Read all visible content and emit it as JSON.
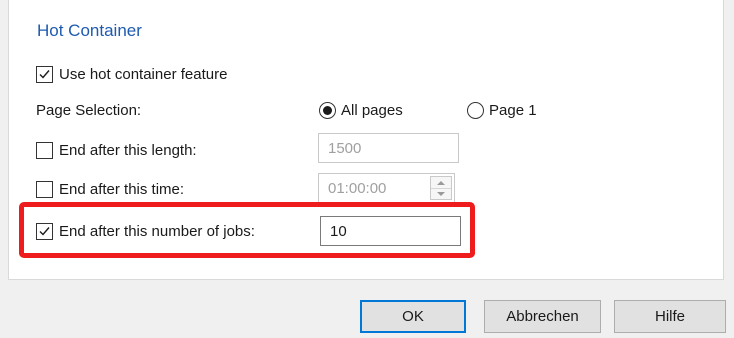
{
  "section": {
    "title": "Hot Container"
  },
  "options": {
    "use_hot_container": {
      "label": "Use hot container feature",
      "checked": true
    },
    "page_selection": {
      "label": "Page Selection:",
      "choices": [
        {
          "label": "All pages",
          "selected": true
        },
        {
          "label": "Page 1",
          "selected": false
        }
      ]
    },
    "end_length": {
      "label": "End after this length:",
      "checked": false,
      "value": "1500"
    },
    "end_time": {
      "label": "End after this time:",
      "checked": false,
      "value": "01:00:00"
    },
    "end_jobs": {
      "label": "End after this number of jobs:",
      "checked": true,
      "value": "10"
    }
  },
  "buttons": {
    "ok": "OK",
    "cancel": "Abbrechen",
    "help": "Hilfe"
  },
  "colors": {
    "title": "#1e5bb0",
    "highlight": "#ee1c1c",
    "default_button_border": "#0078d7"
  }
}
